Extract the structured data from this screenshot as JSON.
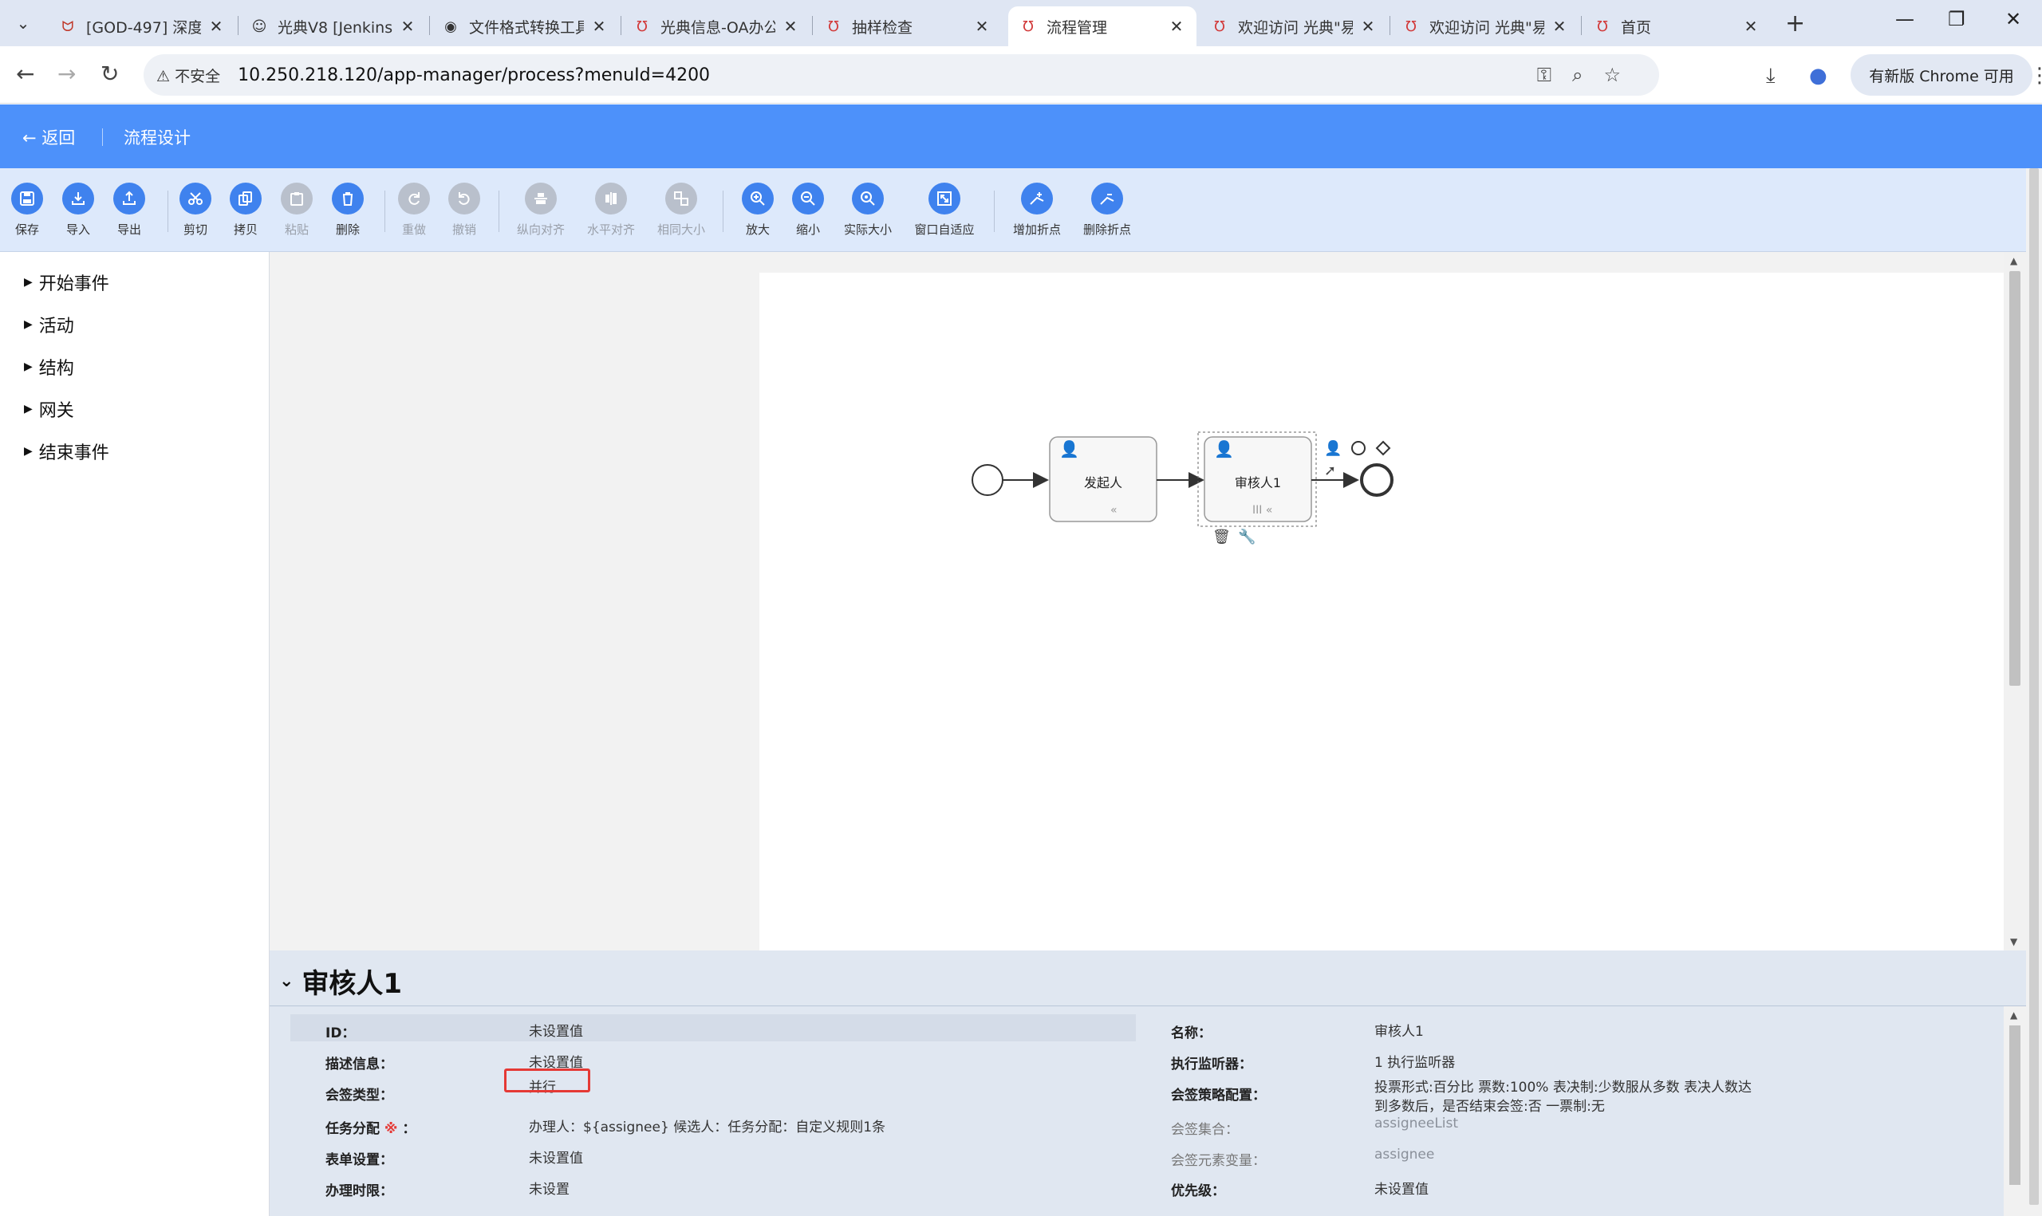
{
  "browser": {
    "tabs": [
      {
        "title": "[GOD-497] 深度",
        "icon": "jira-icon"
      },
      {
        "title": "光典V8 [Jenkins",
        "icon": "jenkins-icon"
      },
      {
        "title": "文件格式转换工具",
        "icon": "globe-icon"
      },
      {
        "title": "光典信息-OA办公",
        "icon": "app-logo-icon"
      },
      {
        "title": "抽样检查",
        "icon": "app-logo-icon"
      },
      {
        "title": "流程管理",
        "icon": "app-logo-icon",
        "active": true
      },
      {
        "title": "欢迎访问 光典\"易",
        "icon": "app-logo-icon"
      },
      {
        "title": "欢迎访问 光典\"易",
        "icon": "app-logo-icon"
      },
      {
        "title": "首页",
        "icon": "app-logo-icon"
      }
    ],
    "insecure_label": "不安全",
    "url": "10.250.218.120/app-manager/process?menuId=4200",
    "update_button": "有新版 Chrome 可用"
  },
  "header": {
    "back_label": "返回",
    "page_title": "流程设计"
  },
  "toolbar": [
    {
      "label": "保存",
      "icon": "save-icon",
      "enabled": true
    },
    {
      "label": "导入",
      "icon": "import-icon",
      "enabled": true
    },
    {
      "label": "导出",
      "icon": "export-icon",
      "enabled": true
    },
    {
      "label": "剪切",
      "icon": "cut-icon",
      "enabled": true
    },
    {
      "label": "拷贝",
      "icon": "copy-icon",
      "enabled": true
    },
    {
      "label": "粘贴",
      "icon": "paste-icon",
      "enabled": false
    },
    {
      "label": "删除",
      "icon": "delete-icon",
      "enabled": true
    },
    {
      "label": "重做",
      "icon": "redo-icon",
      "enabled": false
    },
    {
      "label": "撤销",
      "icon": "undo-icon",
      "enabled": false
    },
    {
      "label": "纵向对齐",
      "icon": "align-vertical-icon",
      "enabled": false
    },
    {
      "label": "水平对齐",
      "icon": "align-horizontal-icon",
      "enabled": false
    },
    {
      "label": "相同大小",
      "icon": "same-size-icon",
      "enabled": false
    },
    {
      "label": "放大",
      "icon": "zoom-in-icon",
      "enabled": true
    },
    {
      "label": "缩小",
      "icon": "zoom-out-icon",
      "enabled": true
    },
    {
      "label": "实际大小",
      "icon": "actual-size-icon",
      "enabled": true
    },
    {
      "label": "窗口自适应",
      "icon": "fit-window-icon",
      "enabled": true
    },
    {
      "label": "增加折点",
      "icon": "add-bend-icon",
      "enabled": true
    },
    {
      "label": "删除折点",
      "icon": "remove-bend-icon",
      "enabled": true
    }
  ],
  "palette": [
    {
      "label": "开始事件"
    },
    {
      "label": "活动"
    },
    {
      "label": "结构"
    },
    {
      "label": "网关"
    },
    {
      "label": "结束事件"
    }
  ],
  "diagram": {
    "task1": "发起人",
    "task2": "审核人1"
  },
  "properties": {
    "title": "审核人1",
    "left": [
      {
        "label": "ID：",
        "value": "未设置值"
      },
      {
        "label": "描述信息：",
        "value": "未设置值"
      },
      {
        "label": "会签类型：",
        "value": "并行"
      },
      {
        "label": "任务分配",
        "required_mark": "※",
        "label_suffix": "：",
        "value": "办理人：${assignee} 候选人：任务分配：自定义规则1条"
      },
      {
        "label": "表单设置：",
        "value": "未设置值"
      },
      {
        "label": "办理时限：",
        "value": "未设置"
      }
    ],
    "right": [
      {
        "label": "名称：",
        "value": "审核人1"
      },
      {
        "label": "执行监听器：",
        "value": "1 执行监听器"
      },
      {
        "label": "会签策略配置：",
        "value": "投票形式:百分比 票数:100% 表决制:少数服从多数 表决人数达",
        "value2": "到多数后，是否结束会签:否 一票制:无"
      },
      {
        "label": "会签集合：",
        "value": "assigneeList",
        "muted": true
      },
      {
        "label": "会签元素变量：",
        "value": "assignee",
        "muted": true
      },
      {
        "label": "优先级：",
        "value": "未设置值"
      }
    ]
  },
  "colors": {
    "header_blue": "#4d91fa",
    "tool_blue": "#3f82ee",
    "highlight_red": "#e53935"
  }
}
